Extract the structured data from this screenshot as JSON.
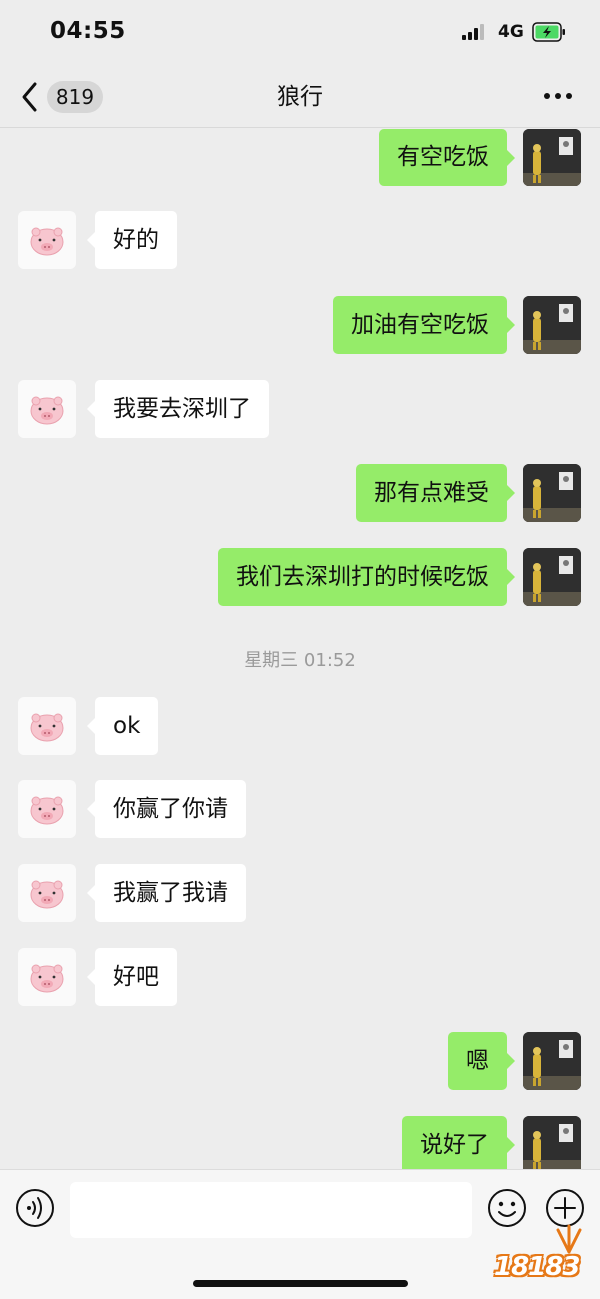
{
  "status_bar": {
    "time": "04:55",
    "network": "4G"
  },
  "nav": {
    "unread_count": "819",
    "title": "狼行"
  },
  "messages": [
    {
      "from": "me",
      "text": "有空吃饭"
    },
    {
      "from": "them",
      "text": "好的"
    },
    {
      "from": "me",
      "text": "加油有空吃饭"
    },
    {
      "from": "them",
      "text": "我要去深圳了"
    },
    {
      "from": "me",
      "text": "那有点难受"
    },
    {
      "from": "me",
      "text": "我们去深圳打的时候吃饭"
    },
    {
      "type": "timestamp",
      "text": "星期三 01:52"
    },
    {
      "from": "them",
      "text": "ok"
    },
    {
      "from": "them",
      "text": "你赢了你请"
    },
    {
      "from": "them",
      "text": "我赢了我请"
    },
    {
      "from": "them",
      "text": "好吧"
    },
    {
      "from": "me",
      "text": "嗯"
    },
    {
      "from": "me",
      "text": "说好了"
    }
  ],
  "input": {
    "value": "",
    "placeholder": ""
  },
  "watermark": {
    "text": "18183"
  },
  "colors": {
    "my_bubble": "#95ec69",
    "their_bubble": "#ffffff",
    "background": "#ededed"
  },
  "icons": [
    "back-icon",
    "more-icon",
    "voice-icon",
    "emoji-icon",
    "add-icon"
  ]
}
